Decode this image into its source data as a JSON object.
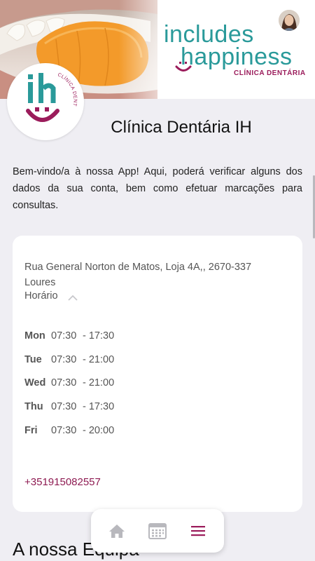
{
  "brand": {
    "line1": "includes",
    "line2": "happiness",
    "tagline": "CLÍNICA DENTÁRIA",
    "logo_text": "CLÍNICA DENTÁRIA",
    "teal": "#2a9a9a",
    "magenta": "#9b1c5b"
  },
  "header": {
    "title": "Clínica Dentária IH"
  },
  "welcome": {
    "text": "Bem-vindo/a à nossa App! Aqui, poderá verificar alguns dos dados da sua conta, bem como efetuar marcações para consultas."
  },
  "info": {
    "address_line1": "Rua General Norton de Matos, Loja 4A,, 2670-337",
    "address_line2": "Loures",
    "hours_label": "Horário",
    "hours": [
      {
        "day": "Mon",
        "open": "07:30",
        "close": "- 17:30"
      },
      {
        "day": "Tue",
        "open": "07:30",
        "close": "- 21:00"
      },
      {
        "day": "Wed",
        "open": "07:30",
        "close": "- 21:00"
      },
      {
        "day": "Thu",
        "open": "07:30",
        "close": "- 17:30"
      },
      {
        "day": "Fri",
        "open": "07:30",
        "close": "- 20:00"
      }
    ],
    "phone": "+351915082557"
  },
  "team": {
    "title": "A nossa Equipa"
  },
  "nav": {
    "items": [
      "home-icon",
      "calendar-icon",
      "menu-icon"
    ],
    "active": "menu-icon"
  }
}
